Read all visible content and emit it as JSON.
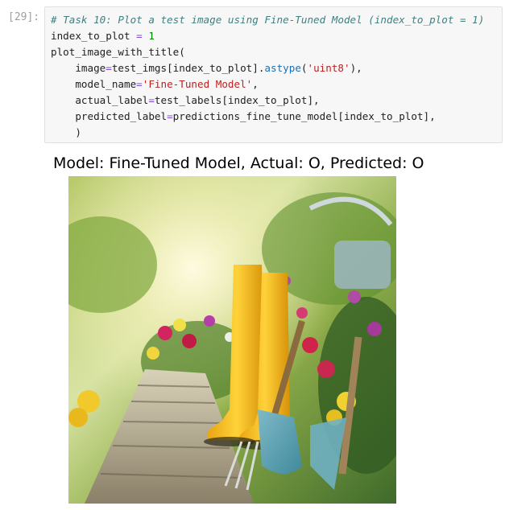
{
  "cell": {
    "prompt": "[29]:",
    "code": {
      "comment": "# Task 10: Plot a test image using Fine-Tuned Model (index_to_plot = 1)",
      "line2_var": "index_to_plot",
      "line2_op": "=",
      "line2_num": "1",
      "line3": "plot_image_with_title(",
      "line4_pre": "    image",
      "line4_op": "=",
      "line4_mid": "test_imgs[index_to_plot].",
      "line4_attr": "astype",
      "line4_open": "(",
      "line4_str": "'uint8'",
      "line4_close": "),",
      "line5_pre": "    model_name",
      "line5_op": "=",
      "line5_str": "'Fine-Tuned Model'",
      "line5_end": ",",
      "line6_pre": "    actual_label",
      "line6_op": "=",
      "line6_rest": "test_labels[index_to_plot],",
      "line7_pre": "    predicted_label",
      "line7_op": "=",
      "line7_rest": "predictions_fine_tune_model[index_to_plot],",
      "line8": "    )"
    }
  },
  "output": {
    "title": "Model: Fine-Tuned Model, Actual: O, Predicted: O",
    "image_icon": "garden-photo"
  }
}
